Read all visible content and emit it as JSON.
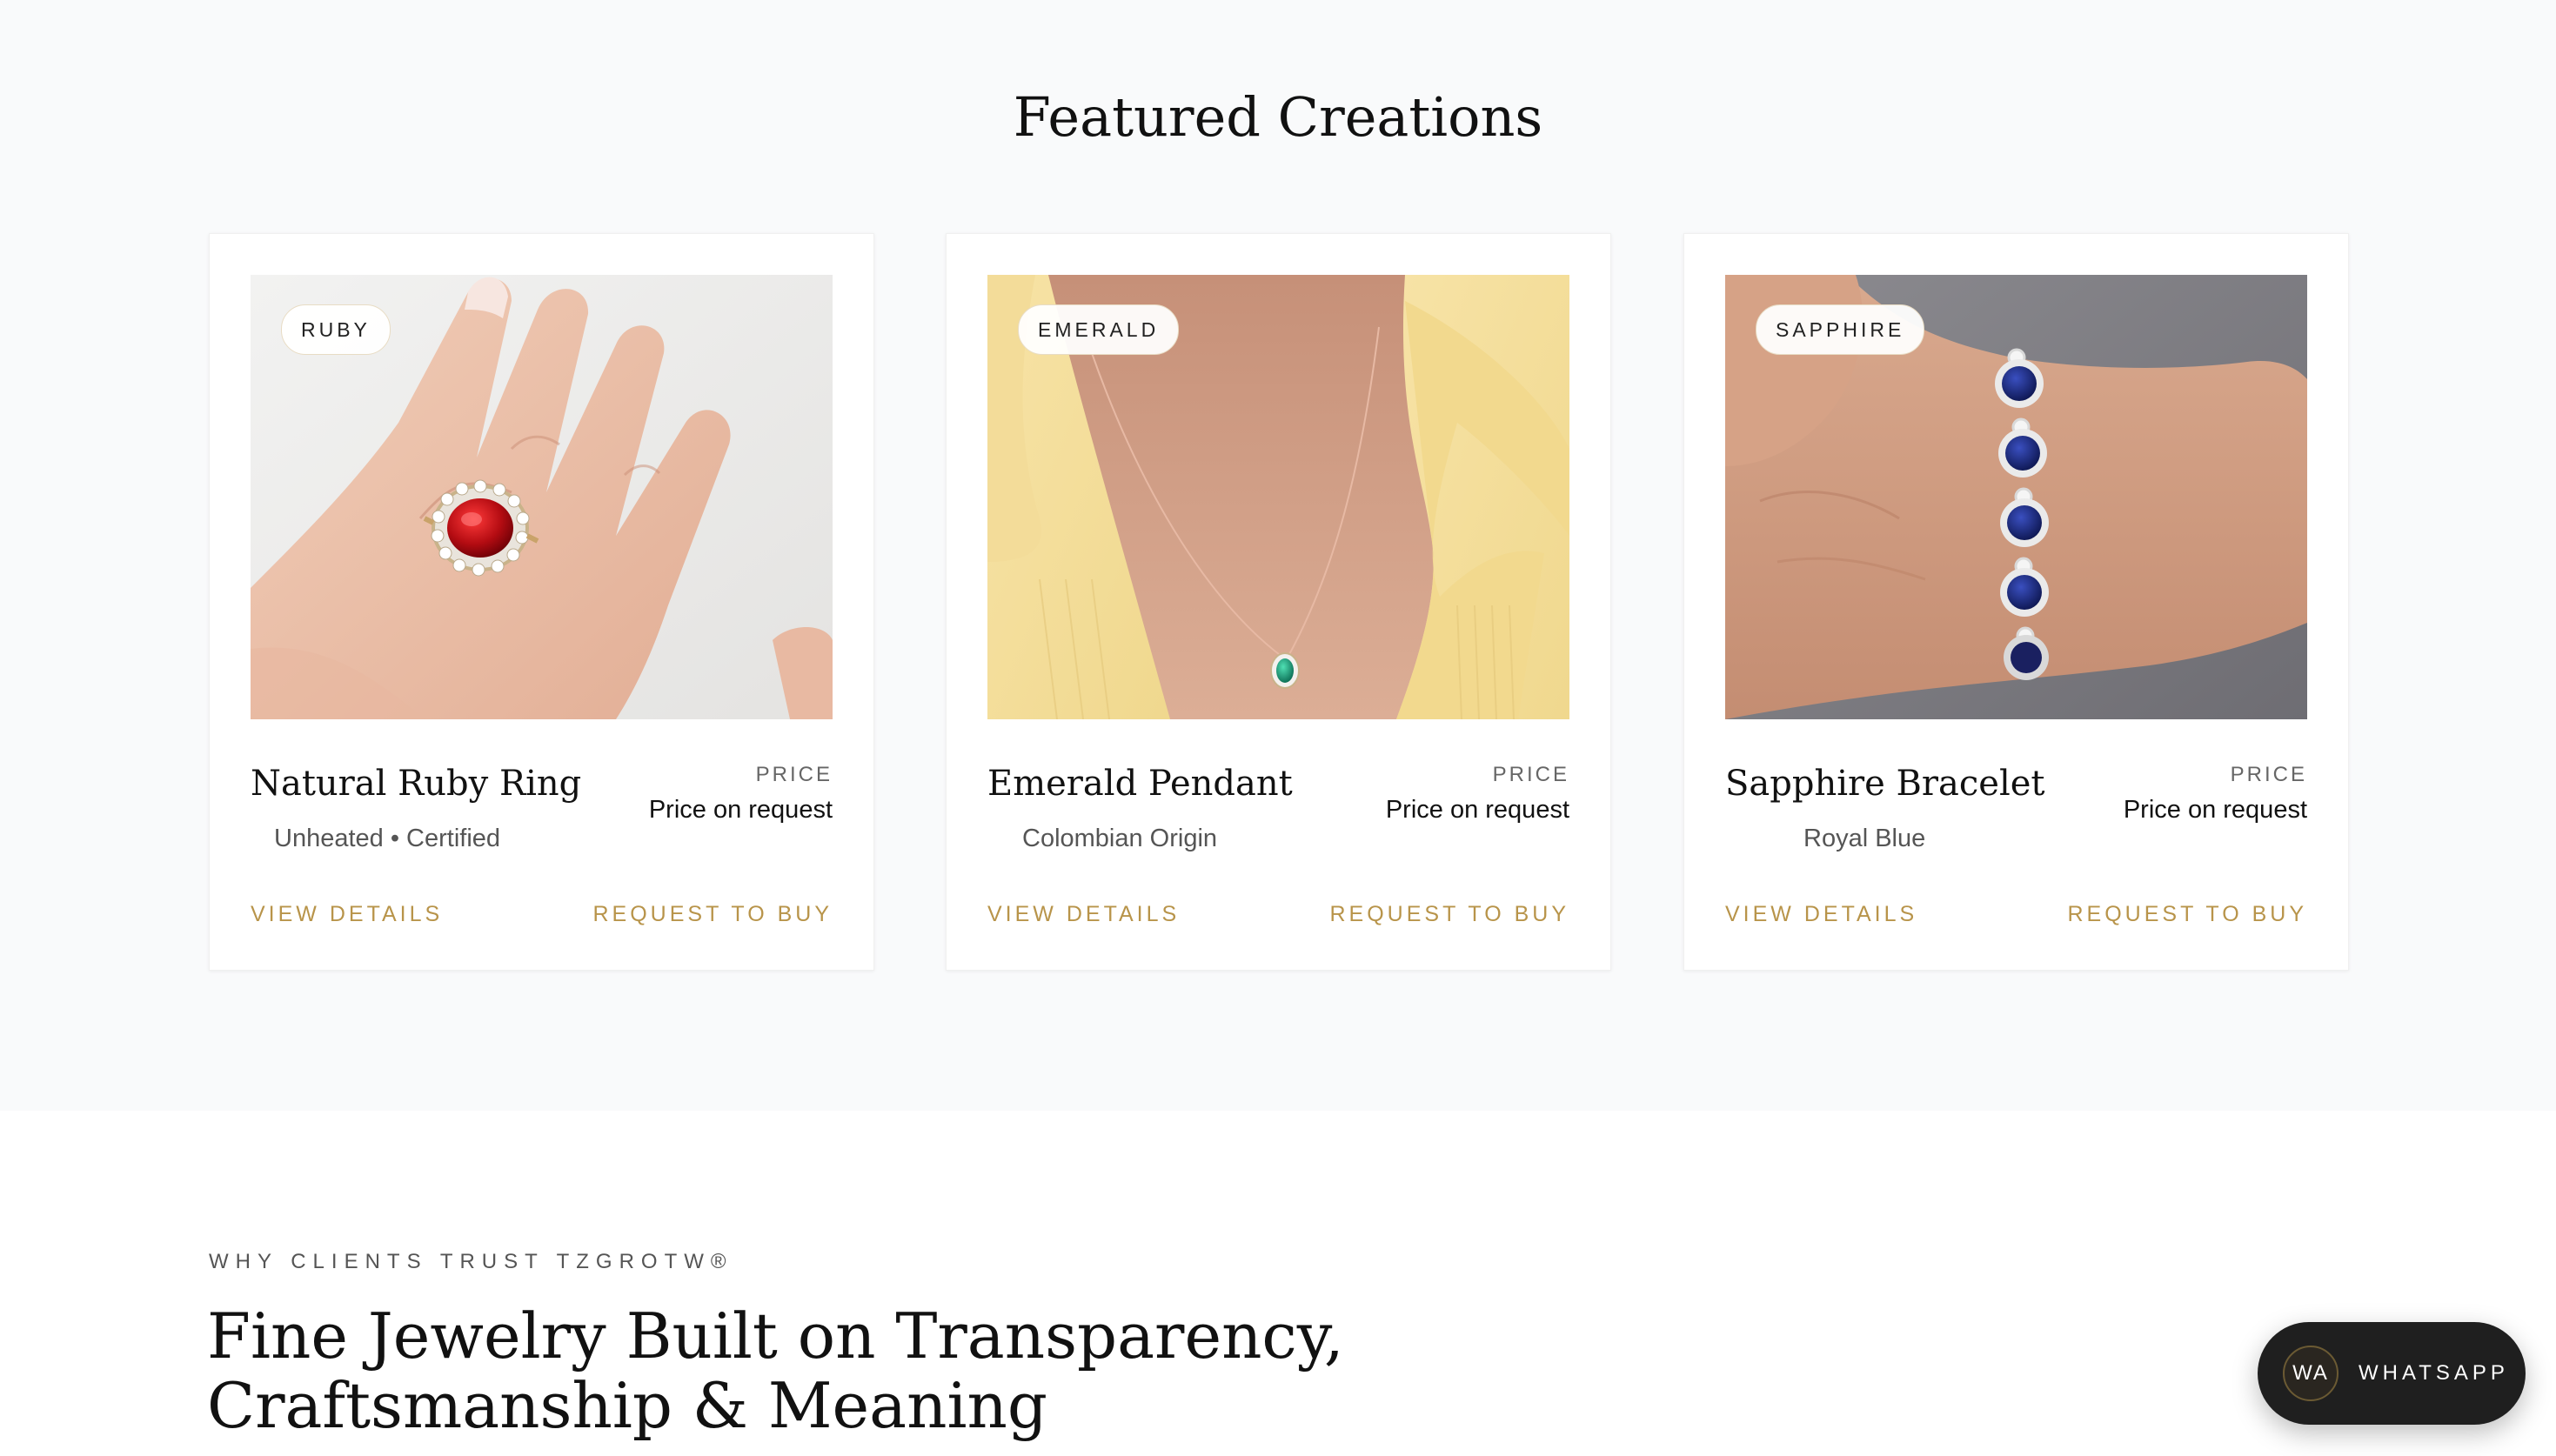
{
  "featured": {
    "title": "Featured Creations",
    "price_label": "PRICE",
    "products": [
      {
        "badge": "RUBY",
        "name": "Natural Ruby Ring",
        "subtitle": "Unheated • Certified",
        "price": "Price on request",
        "view_label": "VIEW DETAILS",
        "buy_label": "REQUEST TO BUY",
        "image": "ruby-ring-on-hand"
      },
      {
        "badge": "EMERALD",
        "name": "Emerald Pendant",
        "subtitle": "Colombian Origin",
        "price": "Price on request",
        "view_label": "VIEW DETAILS",
        "buy_label": "REQUEST TO BUY",
        "image": "emerald-pendant-on-neck"
      },
      {
        "badge": "SAPPHIRE",
        "name": "Sapphire Bracelet",
        "subtitle": "Royal Blue",
        "price": "Price on request",
        "view_label": "VIEW DETAILS",
        "buy_label": "REQUEST TO BUY",
        "image": "sapphire-bracelet-on-wrist"
      }
    ]
  },
  "trust": {
    "eyebrow": "WHY CLIENTS TRUST TZGROTW®",
    "heading_line1": "Fine Jewelry Built on Transparency,",
    "heading_line2": "Craftsmanship & Meaning"
  },
  "whatsapp": {
    "icon_text": "WA",
    "label": "WHATSAPP"
  },
  "colors": {
    "accent_gold": "#b8944a",
    "section_bg": "#f9fafb",
    "whatsapp_bg": "#1f1f1f"
  }
}
